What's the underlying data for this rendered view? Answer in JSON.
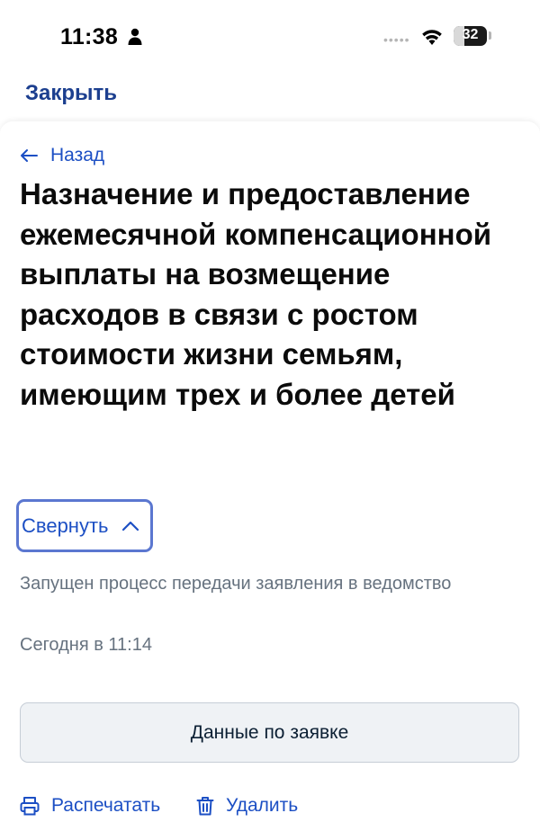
{
  "status_bar": {
    "time": "11:38",
    "battery": "32",
    "battery_level": 0.32,
    "signal_dots": "•••••"
  },
  "top": {
    "close_label": "Закрыть"
  },
  "sheet": {
    "back_label": "Назад",
    "title": "Назначение и предоставление ежемесячной компенсационной выплаты на возмещение расходов в связи с ростом стоимости жизни семьям, имеющим трех и более детей",
    "collapse_label": "Свернуть",
    "status_text": "Запущен процесс передачи заявления в ведомство",
    "timestamp": "Сегодня в 11:14",
    "details_button_label": "Данные по заявке",
    "print_label": "Распечатать",
    "delete_label": "Удалить"
  },
  "colors": {
    "accent": "#1c4fc4",
    "close_link": "#1c3f8f",
    "focus_ring": "#5b77d0",
    "muted_text": "#66727f",
    "button_bg": "#eff2f5"
  },
  "icons": {
    "person": "person-icon",
    "wifi": "wifi-icon",
    "back": "arrow-left-icon",
    "collapse": "chevron-up-icon",
    "print": "printer-icon",
    "delete": "trash-icon"
  }
}
